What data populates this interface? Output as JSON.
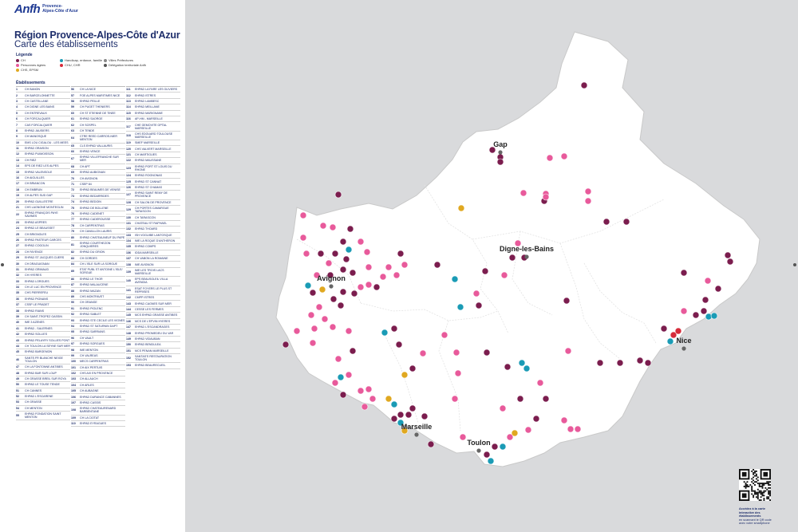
{
  "brand": {
    "logo": "Anfh",
    "sub1": "Provence-",
    "sub2": "Alpes-Côte d'Azur"
  },
  "title": {
    "line1": "Région Provence-Alpes-Côte d'Azur",
    "line2": "Carte des établissements"
  },
  "legend": {
    "heading": "Légende",
    "items": [
      {
        "label": "CH",
        "color": "#7b1d4e"
      },
      {
        "label": "Handicap, enfance, famille",
        "color": "#1a9bb5"
      },
      {
        "label": "Villes Préfectures",
        "color": "#888888"
      },
      {
        "label": "Personnes âgées",
        "color": "#e85a9b"
      },
      {
        "label": "CHU, CHR",
        "color": "#d62b3a"
      },
      {
        "label": "Délégation territoriale Anfh",
        "color": "#555555"
      },
      {
        "label": "CHS, EPSM",
        "color": "#e0a820"
      }
    ]
  },
  "establishments": {
    "heading": "Établissements",
    "columns": [
      [
        [
          "1",
          "CH BANON"
        ],
        [
          "2",
          "CH BARCELONNETTE"
        ],
        [
          "3",
          "CH CASTELLANE"
        ],
        [
          "4",
          "CH DIGNE LES BAINS"
        ],
        [
          "5",
          "CH ENTREVAUX"
        ],
        [
          "6",
          "CH FORCALQUIER"
        ],
        [
          "7",
          "CAS FORCALQUIER"
        ],
        [
          "8",
          "EHPAD JAUSIERS"
        ],
        [
          "9",
          "CH MANOSQUE"
        ],
        [
          "10",
          "EMS LOU CIGALOU - LES MEES"
        ],
        [
          "11",
          "EHPAD ORAISON"
        ],
        [
          "12",
          "EHPAD PUIMOISSON"
        ],
        [
          "13",
          "CH RIEZ"
        ],
        [
          "14",
          "EPS DE RIEZ LES ALPES"
        ],
        [
          "15",
          "EHPAD VALENSOLE"
        ],
        [
          "16",
          "CH AIGUILLES"
        ],
        [
          "17",
          "CH BRIANCON"
        ],
        [
          "18",
          "CH EMBRUN"
        ],
        [
          "19",
          "CH ALPES SUD GAP"
        ],
        [
          "20",
          "EHPAD GUILLESTRE"
        ],
        [
          "21",
          "CHS LAGNONE MONTEGLIN"
        ],
        [
          "22",
          "EHPAD FRANÇOIS PAYE SAVINES"
        ],
        [
          "23",
          "EHPAD ASPRES"
        ],
        [
          "24",
          "EHPAD LE BEAUSSET"
        ],
        [
          "25",
          "CH BRIGNOLES"
        ],
        [
          "26",
          "EHPAD PASTEUR CARCES"
        ],
        [
          "27",
          "EHPAD COGOLIN"
        ],
        [
          "28",
          "CH FAYENCE"
        ],
        [
          "29",
          "EHPAD ST JACQUES CUERS"
        ],
        [
          "30",
          "CH DRAGUIGNAN"
        ],
        [
          "31",
          "EHPAD GRIMAUD"
        ],
        [
          "32",
          "CH HYERES"
        ],
        [
          "33",
          "EHPAD LORGUES"
        ],
        [
          "34",
          "CH LE LUC EN PROVENCE"
        ],
        [
          "35",
          "CHS PIERREFEU"
        ],
        [
          "36",
          "EHPAD PIGNANS"
        ],
        [
          "37",
          "CSSP LE PRADET"
        ],
        [
          "38",
          "EHPAD RIANS"
        ],
        [
          "39",
          "CH SAINT-TROPEZ GASSIN"
        ],
        [
          "40",
          "IME 3 AZENES"
        ],
        [
          "41",
          "EHPAD - SALERNES"
        ],
        [
          "42",
          "EHPAD SOLLIES"
        ],
        [
          "43",
          "EHPAD PELAYRY SOLLIES PONT"
        ],
        [
          "44",
          "CH TOULON LA SEYNE SUR MER"
        ],
        [
          "45",
          "EHPAD BARGEMON"
        ],
        [
          "46",
          "SANTE.FR BLANCHE NEIGE TOULON"
        ],
        [
          "47",
          "CH LA FONTONNE ANTIBES"
        ],
        [
          "48",
          "EHPAD BAR SUR LOUP"
        ],
        [
          "49",
          "CH GRASSE BREIL SUR ROYA"
        ],
        [
          "50",
          "EHPAD LE TOUSE TENDE"
        ],
        [
          "51",
          "CH CANNES"
        ],
        [
          "52",
          "EHPAD L'ESCARENE"
        ],
        [
          "53",
          "CH GRASSE"
        ],
        [
          "54",
          "CH MENTON"
        ],
        [
          "55",
          "EHPAD FONDATION SAINT MENTON"
        ]
      ],
      [
        [
          "56",
          "CH LA NICE"
        ],
        [
          "57",
          "FOE ALPES MARITIMES NICE"
        ],
        [
          "58",
          "EHPAD PEILLE"
        ],
        [
          "59",
          "CH PUGET THENIERS"
        ],
        [
          "60",
          "CH ST ETIENNE DE TINEE"
        ],
        [
          "61",
          "EHPAD SAORGE"
        ],
        [
          "62",
          "CH SOSPEL"
        ],
        [
          "63",
          "CH TENDE"
        ],
        [
          "64",
          "CTRE REED CARROS-NIER MENTON"
        ],
        [
          "65",
          "CLS EHPAD VALLAURIS"
        ],
        [
          "66",
          "EHPAD VENCE"
        ],
        [
          "67",
          "EHPAD VILLEFRANCHE SUR MER"
        ],
        [
          "68",
          "CH APT"
        ],
        [
          "69",
          "EHPAD AUBIGNAN"
        ],
        [
          "70",
          "CH AVIGNON"
        ],
        [
          "71",
          "CSEP 84"
        ],
        [
          "72",
          "EHPAD BEAUMES DE VENISE"
        ],
        [
          "73",
          "EHPAD BEDARRIDES"
        ],
        [
          "74",
          "EHPAD BEDOIN"
        ],
        [
          "75",
          "EHPAD DE BOLLENE"
        ],
        [
          "76",
          "EHPAD CADENET"
        ],
        [
          "77",
          "EHPAD CADEROUSSE"
        ],
        [
          "78",
          "CH CARPENTRAS"
        ],
        [
          "79",
          "CH CAVAILLON LAURIS"
        ],
        [
          "80",
          "EHPAD CHATEAUNEUF DU PAPE"
        ],
        [
          "81",
          "EHPAD COURTHEZON JONQUIERES"
        ],
        [
          "82",
          "EHPAD DU GRION"
        ],
        [
          "83",
          "CH GORDES"
        ],
        [
          "84",
          "CH L'ISLE SUR LA SORGUE"
        ],
        [
          "85",
          "ETAT PUBL ST ANTOINE L'ISLE/ SORGUE"
        ],
        [
          "86",
          "EHPAD LE THOR"
        ],
        [
          "87",
          "EHPAD MALAUCENE"
        ],
        [
          "88",
          "EHPAD MAZAN"
        ],
        [
          "89",
          "CHS MONTFAVET"
        ],
        [
          "90",
          "CH ORANGE"
        ],
        [
          "91",
          "EHPAD PIOLENC"
        ],
        [
          "92",
          "EHPAD SABLET"
        ],
        [
          "93",
          "EHPAD STE CECILE LES VIGNES"
        ],
        [
          "94",
          "EHPAD ST SATURNIN DAPT"
        ],
        [
          "95",
          "EHPAD SARRIANS"
        ],
        [
          "96",
          "CH VAULT"
        ],
        [
          "97",
          "EHPAD SORGUES"
        ],
        [
          "98",
          "IME MENTON"
        ],
        [
          "99",
          "CH VALREAS"
        ],
        [
          "100",
          "MECS CARPENTRAS"
        ],
        [
          "101",
          "CH AIX PERTUIS"
        ],
        [
          "102",
          "CHS AIX EN PROVENCE"
        ],
        [
          "103",
          "CH ALLAUCH"
        ],
        [
          "104",
          "CH ARLES"
        ],
        [
          "105",
          "CH AUBAGNE"
        ],
        [
          "106",
          "EHPAD DURANCE CABANNES"
        ],
        [
          "107",
          "EHPAD CASSIS"
        ],
        [
          "108",
          "EHPAD CHATEAURENARD BARBENTANE"
        ],
        [
          "109",
          "CH LA CIOTAT"
        ],
        [
          "110",
          "EHPAD EYRAGUES"
        ]
      ],
      [
        [
          "111",
          "EHPAD LA FARE LES OLIVIERS"
        ],
        [
          "112",
          "EHPAD ISTRES"
        ],
        [
          "113",
          "EHPAD LAMBESC"
        ],
        [
          "114",
          "EHPAD MEILLANE"
        ],
        [
          "115",
          "EHPAD MARIGNANE"
        ],
        [
          "116",
          "AP-HM - MARSEILLE"
        ],
        [
          "117",
          "CHE GEMOVITE OPTAL MARSEILLE"
        ],
        [
          "118",
          "CHS EDOUARD TOULOUSE MARSEILLE"
        ],
        [
          "119",
          "SMEF MARSEILLE"
        ],
        [
          "120",
          "CHS VALVERT MARSEILLE"
        ],
        [
          "121",
          "CH MARTIGUES"
        ],
        [
          "122",
          "EHPAD MAUSSANE"
        ],
        [
          "123",
          "EHPAD PORT ST LOUIS DU RHONE"
        ],
        [
          "124",
          "EHPAD ROGNONAS"
        ],
        [
          "125",
          "EHPAD ST CANNAT"
        ],
        [
          "126",
          "EHPAD ST CHAMAS"
        ],
        [
          "127",
          "EHPAD SAINT REMY DE PROVENCE"
        ],
        [
          "128",
          "CH SALON DE PROVENCE"
        ],
        [
          "129",
          "CH PORTES CAMARGUE TARASCON"
        ],
        [
          "130",
          "CH TARASCON"
        ],
        [
          "131",
          "CHATEAU ST RAPHAEL"
        ],
        [
          "132",
          "EHPAD THOARD"
        ],
        [
          "133",
          "ISH VOGUIBE LANTOSQUE"
        ],
        [
          "134",
          "IME LA ROQUE D'ANTHERON"
        ],
        [
          "135",
          "EHPAD COMPS"
        ],
        [
          "136",
          "IDDA MARSEILLE"
        ],
        [
          "137",
          "CH VABON LA ROMAINE"
        ],
        [
          "138",
          "IME AVIGNON"
        ],
        [
          "139",
          "IME LES TROIS LACS MARSEILLE"
        ],
        [
          "140",
          "EPS BEAUSOLEIL VILLA AVENDIA"
        ],
        [
          "141",
          "ESAT FOYERS LE PLUS ST REPRISES"
        ],
        [
          "142",
          "CMPP ISTRES"
        ],
        [
          "143",
          "EHPAD CAGNES SUR MER"
        ],
        [
          "144",
          "CESSE LES FERMES"
        ],
        [
          "145",
          "MCS EHPAD GRASSE ANTIBES"
        ],
        [
          "146",
          "MCS DE L'EPVIN HYERES"
        ],
        [
          "147",
          "EHPAD L'ESCANDRAGES"
        ],
        [
          "148",
          "EHPAD PROMEDEU DU VAR"
        ],
        [
          "149",
          "EHPAD VIDAUBAN"
        ],
        [
          "150",
          "EHPAD BENDULEA"
        ],
        [
          "151",
          "MCS PENAN MARSEILLE"
        ],
        [
          "152",
          "SANTAS'S RESTAURATION TOULON"
        ],
        [
          "153",
          "EHPAD BEAURECUEIL"
        ]
      ]
    ]
  },
  "map": {
    "cities": [
      {
        "name": "Gap"
      },
      {
        "name": "Digne-les-Bains"
      },
      {
        "name": "Avignon"
      },
      {
        "name": "Marseille"
      },
      {
        "name": "Toulon"
      },
      {
        "name": "Nice"
      }
    ]
  },
  "qr": {
    "title": "Accédez à la carte interactive des établissements",
    "body": "en scannant le QR code avec votre smartphone"
  }
}
